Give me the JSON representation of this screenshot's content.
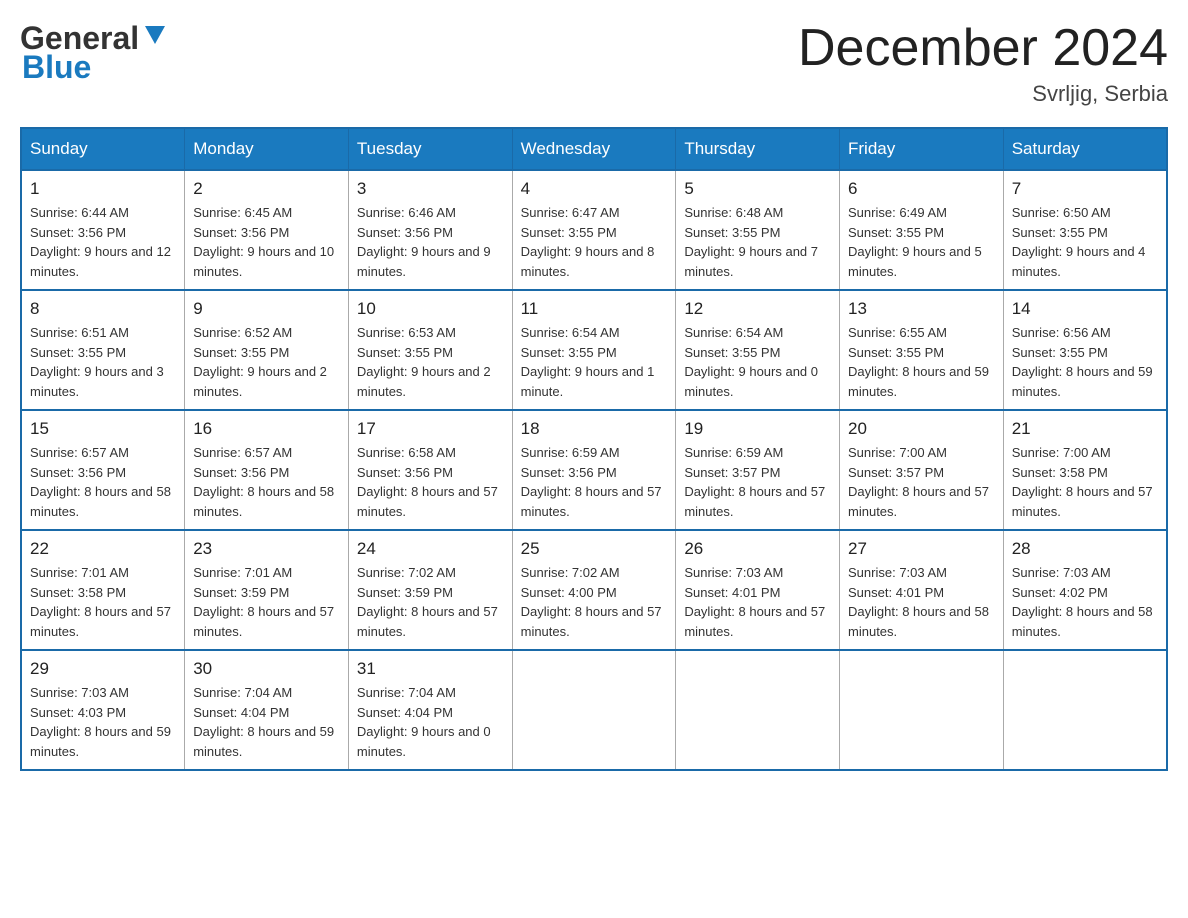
{
  "header": {
    "logo": {
      "general": "General",
      "blue": "Blue",
      "triangle_color": "#1a6aa8"
    },
    "title": "December 2024",
    "location": "Svrljig, Serbia"
  },
  "calendar": {
    "days_of_week": [
      "Sunday",
      "Monday",
      "Tuesday",
      "Wednesday",
      "Thursday",
      "Friday",
      "Saturday"
    ],
    "weeks": [
      [
        {
          "day": "1",
          "sunrise": "6:44 AM",
          "sunset": "3:56 PM",
          "daylight": "9 hours and 12 minutes."
        },
        {
          "day": "2",
          "sunrise": "6:45 AM",
          "sunset": "3:56 PM",
          "daylight": "9 hours and 10 minutes."
        },
        {
          "day": "3",
          "sunrise": "6:46 AM",
          "sunset": "3:56 PM",
          "daylight": "9 hours and 9 minutes."
        },
        {
          "day": "4",
          "sunrise": "6:47 AM",
          "sunset": "3:55 PM",
          "daylight": "9 hours and 8 minutes."
        },
        {
          "day": "5",
          "sunrise": "6:48 AM",
          "sunset": "3:55 PM",
          "daylight": "9 hours and 7 minutes."
        },
        {
          "day": "6",
          "sunrise": "6:49 AM",
          "sunset": "3:55 PM",
          "daylight": "9 hours and 5 minutes."
        },
        {
          "day": "7",
          "sunrise": "6:50 AM",
          "sunset": "3:55 PM",
          "daylight": "9 hours and 4 minutes."
        }
      ],
      [
        {
          "day": "8",
          "sunrise": "6:51 AM",
          "sunset": "3:55 PM",
          "daylight": "9 hours and 3 minutes."
        },
        {
          "day": "9",
          "sunrise": "6:52 AM",
          "sunset": "3:55 PM",
          "daylight": "9 hours and 2 minutes."
        },
        {
          "day": "10",
          "sunrise": "6:53 AM",
          "sunset": "3:55 PM",
          "daylight": "9 hours and 2 minutes."
        },
        {
          "day": "11",
          "sunrise": "6:54 AM",
          "sunset": "3:55 PM",
          "daylight": "9 hours and 1 minute."
        },
        {
          "day": "12",
          "sunrise": "6:54 AM",
          "sunset": "3:55 PM",
          "daylight": "9 hours and 0 minutes."
        },
        {
          "day": "13",
          "sunrise": "6:55 AM",
          "sunset": "3:55 PM",
          "daylight": "8 hours and 59 minutes."
        },
        {
          "day": "14",
          "sunrise": "6:56 AM",
          "sunset": "3:55 PM",
          "daylight": "8 hours and 59 minutes."
        }
      ],
      [
        {
          "day": "15",
          "sunrise": "6:57 AM",
          "sunset": "3:56 PM",
          "daylight": "8 hours and 58 minutes."
        },
        {
          "day": "16",
          "sunrise": "6:57 AM",
          "sunset": "3:56 PM",
          "daylight": "8 hours and 58 minutes."
        },
        {
          "day": "17",
          "sunrise": "6:58 AM",
          "sunset": "3:56 PM",
          "daylight": "8 hours and 57 minutes."
        },
        {
          "day": "18",
          "sunrise": "6:59 AM",
          "sunset": "3:56 PM",
          "daylight": "8 hours and 57 minutes."
        },
        {
          "day": "19",
          "sunrise": "6:59 AM",
          "sunset": "3:57 PM",
          "daylight": "8 hours and 57 minutes."
        },
        {
          "day": "20",
          "sunrise": "7:00 AM",
          "sunset": "3:57 PM",
          "daylight": "8 hours and 57 minutes."
        },
        {
          "day": "21",
          "sunrise": "7:00 AM",
          "sunset": "3:58 PM",
          "daylight": "8 hours and 57 minutes."
        }
      ],
      [
        {
          "day": "22",
          "sunrise": "7:01 AM",
          "sunset": "3:58 PM",
          "daylight": "8 hours and 57 minutes."
        },
        {
          "day": "23",
          "sunrise": "7:01 AM",
          "sunset": "3:59 PM",
          "daylight": "8 hours and 57 minutes."
        },
        {
          "day": "24",
          "sunrise": "7:02 AM",
          "sunset": "3:59 PM",
          "daylight": "8 hours and 57 minutes."
        },
        {
          "day": "25",
          "sunrise": "7:02 AM",
          "sunset": "4:00 PM",
          "daylight": "8 hours and 57 minutes."
        },
        {
          "day": "26",
          "sunrise": "7:03 AM",
          "sunset": "4:01 PM",
          "daylight": "8 hours and 57 minutes."
        },
        {
          "day": "27",
          "sunrise": "7:03 AM",
          "sunset": "4:01 PM",
          "daylight": "8 hours and 58 minutes."
        },
        {
          "day": "28",
          "sunrise": "7:03 AM",
          "sunset": "4:02 PM",
          "daylight": "8 hours and 58 minutes."
        }
      ],
      [
        {
          "day": "29",
          "sunrise": "7:03 AM",
          "sunset": "4:03 PM",
          "daylight": "8 hours and 59 minutes."
        },
        {
          "day": "30",
          "sunrise": "7:04 AM",
          "sunset": "4:04 PM",
          "daylight": "8 hours and 59 minutes."
        },
        {
          "day": "31",
          "sunrise": "7:04 AM",
          "sunset": "4:04 PM",
          "daylight": "9 hours and 0 minutes."
        },
        null,
        null,
        null,
        null
      ]
    ],
    "labels": {
      "sunrise": "Sunrise: ",
      "sunset": "Sunset: ",
      "daylight": "Daylight: "
    }
  }
}
